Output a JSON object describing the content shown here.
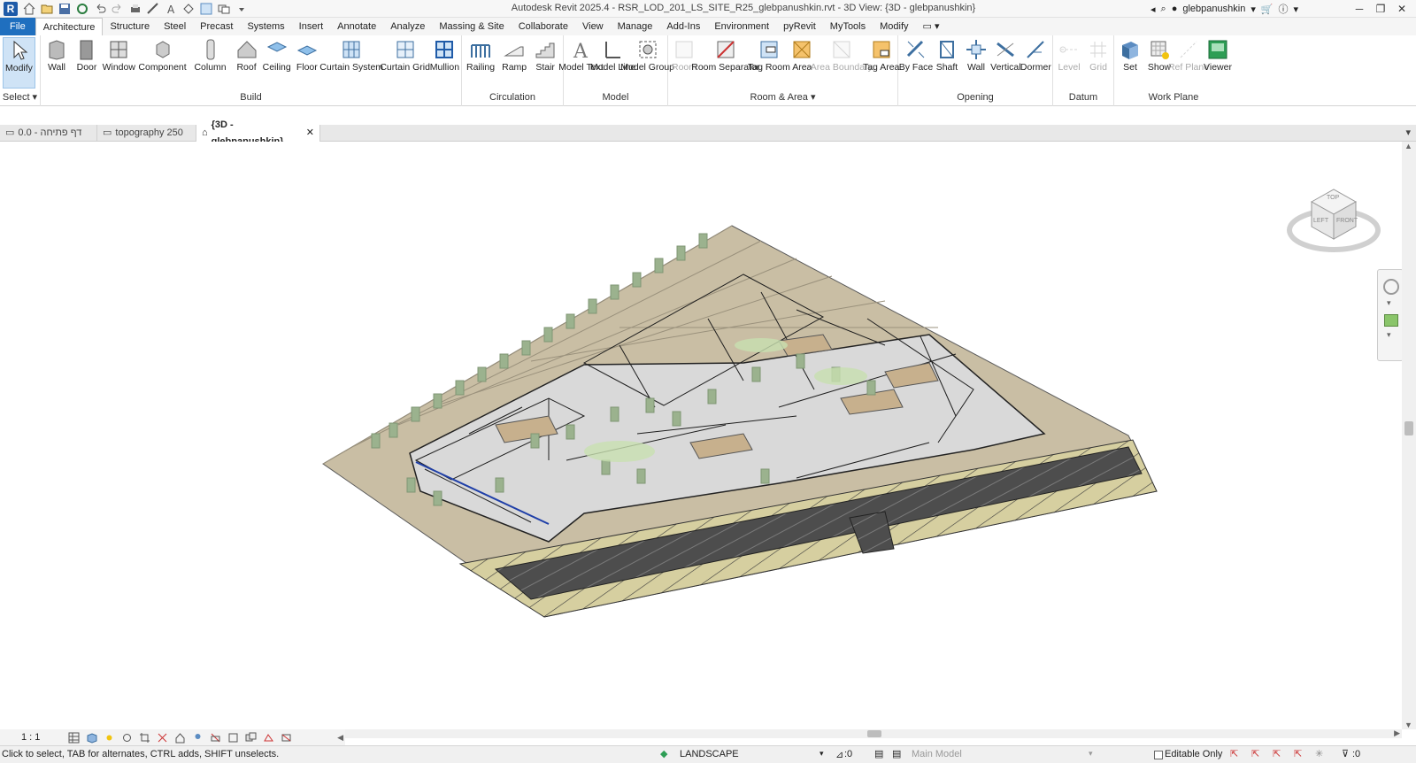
{
  "app": {
    "logo": "R",
    "title": "Autodesk Revit 2025.4 - RSR_LOD_201_LS_SITE_R25_glebpanushkin.rvt - 3D View: {3D - glebpanushkin}",
    "user": "glebpanushkin"
  },
  "tabs": [
    "File",
    "Architecture",
    "Structure",
    "Steel",
    "Precast",
    "Systems",
    "Insert",
    "Annotate",
    "Analyze",
    "Massing & Site",
    "Collaborate",
    "View",
    "Manage",
    "Add-Ins",
    "Environment",
    "pyRevit",
    "MyTools",
    "Modify"
  ],
  "ribbon": {
    "select": {
      "label": "Select",
      "modify": "Modify"
    },
    "build": {
      "label": "Build",
      "items": [
        "Wall",
        "Door",
        "Window",
        "Component",
        "Column",
        "Roof",
        "Ceiling",
        "Floor",
        "Curtain System",
        "Curtain Grid",
        "Mullion"
      ]
    },
    "circulation": {
      "label": "Circulation",
      "items": [
        "Railing",
        "Ramp",
        "Stair"
      ]
    },
    "model": {
      "label": "Model",
      "items": [
        "Model Text",
        "Model Line",
        "Model Group"
      ]
    },
    "room": {
      "label": "Room & Area",
      "items": [
        "Room",
        "Room Separator",
        "Tag Room",
        "Area",
        "Area Boundary",
        "Tag Area"
      ]
    },
    "opening": {
      "label": "Opening",
      "items": [
        "By Face",
        "Shaft",
        "Wall",
        "Vertical",
        "Dormer"
      ]
    },
    "datum": {
      "label": "Datum",
      "items": [
        "Level",
        "Grid"
      ]
    },
    "workplane": {
      "label": "Work Plane",
      "items": [
        "Set",
        "Show",
        "Ref Plane",
        "Viewer"
      ]
    }
  },
  "view_tabs": [
    {
      "label": "דף פתיחה - 0.0",
      "active": false
    },
    {
      "label": "topography 250",
      "active": false
    },
    {
      "label": "{3D - glebpanushkin}",
      "active": true
    }
  ],
  "viewcube": {
    "top": "TOP",
    "left": "LEFT",
    "front": "FRONT"
  },
  "view_control": {
    "scale": "1 : 1"
  },
  "status": {
    "hint": "Click to select, TAB for alternates, CTRL adds, SHIFT unselects.",
    "workset": "LANDSCAPE",
    "selected": ":0",
    "model": "Main Model",
    "editable": "Editable Only",
    "filter": ":0"
  },
  "colors": {
    "accent": "#1f6fbf",
    "ground": "#c9bea4",
    "road": "#4d4d4d",
    "tree": "#9bb28e",
    "building": "#d9d9d9"
  }
}
